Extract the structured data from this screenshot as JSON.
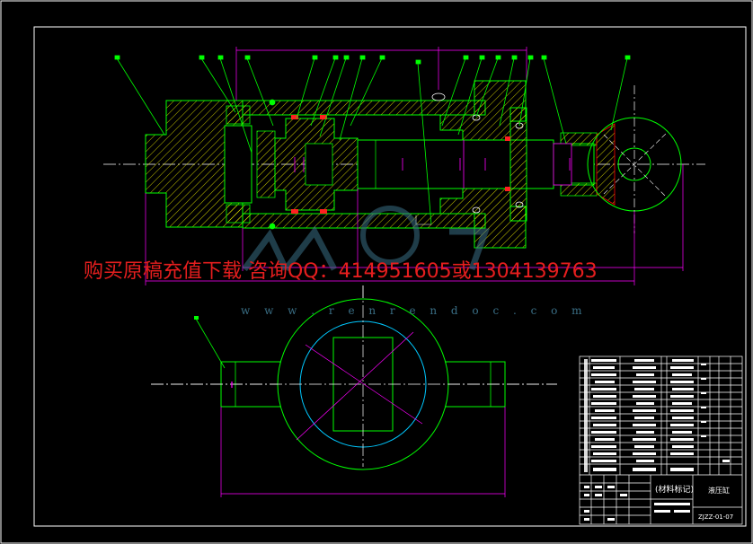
{
  "watermark": {
    "text": "购买原稿充值下载 咨询QQ：414951605或1304139763",
    "url": "w w w . r e n r e n d o c . c o m"
  },
  "title_block": {
    "material_note": "(材料标记)",
    "part_name": "液压缸",
    "drawing_number": "ZJZZ-01-07"
  },
  "colors": {
    "outline": "#00ff00",
    "dimension": "#ff00ff",
    "hatch": "#ffff00",
    "center": "#ffffff",
    "circle_inner": "#00c8ff",
    "watermark": "#e51e1e"
  }
}
